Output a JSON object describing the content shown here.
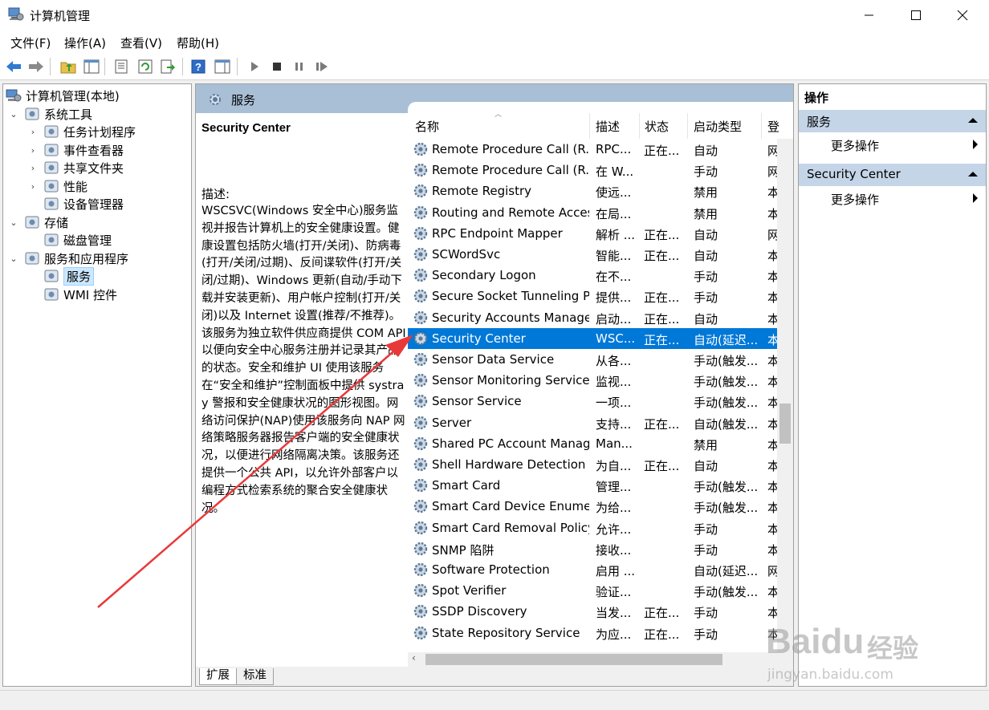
{
  "window": {
    "title": "计算机管理"
  },
  "menu": [
    "文件(F)",
    "操作(A)",
    "查看(V)",
    "帮助(H)"
  ],
  "tree": {
    "root": "计算机管理(本地)",
    "items": [
      {
        "label": "系统工具",
        "level": 1,
        "chevron": "⌄",
        "icon": "tools-icon"
      },
      {
        "label": "任务计划程序",
        "level": 2,
        "chevron": "›",
        "icon": "clock-icon"
      },
      {
        "label": "事件查看器",
        "level": 2,
        "chevron": "›",
        "icon": "event-viewer-icon"
      },
      {
        "label": "共享文件夹",
        "level": 2,
        "chevron": "›",
        "icon": "shared-folder-icon"
      },
      {
        "label": "性能",
        "level": 2,
        "chevron": "›",
        "icon": "performance-icon"
      },
      {
        "label": "设备管理器",
        "level": 2,
        "chevron": "",
        "icon": "device-manager-icon"
      },
      {
        "label": "存储",
        "level": 1,
        "chevron": "⌄",
        "icon": "storage-icon"
      },
      {
        "label": "磁盘管理",
        "level": 2,
        "chevron": "",
        "icon": "disk-icon"
      },
      {
        "label": "服务和应用程序",
        "level": 1,
        "chevron": "⌄",
        "icon": "services-apps-icon"
      },
      {
        "label": "服务",
        "level": 2,
        "chevron": "",
        "icon": "gear-icon",
        "selected": true
      },
      {
        "label": "WMI 控件",
        "level": 2,
        "chevron": "",
        "icon": "wmi-icon"
      }
    ]
  },
  "center": {
    "header": "服务",
    "detail_title": "Security Center",
    "desc_label": "描述:",
    "desc_body": "WSCSVC(Windows 安全中心)服务监视并报告计算机上的安全健康设置。健康设置包括防火墙(打开/关闭)、防病毒(打开/关闭/过期)、反间谍软件(打开/关闭/过期)、Windows 更新(自动/手动下载并安装更新)、用户帐户控制(打开/关闭)以及 Internet 设置(推荐/不推荐)。该服务为独立软件供应商提供 COM API 以便向安全中心服务注册并记录其产品的状态。安全和维护 UI 使用该服务在“安全和维护”控制面板中提供 systray 警报和安全健康状况的图形视图。网络访问保护(NAP)使用该服务向 NAP 网络策略服务器报告客户端的安全健康状况，以便进行网络隔离决策。该服务还提供一个公共 API，以允许外部客户以编程方式检索系统的聚合安全健康状况。",
    "columns": {
      "name": "名称",
      "desc": "描述",
      "state": "状态",
      "type": "启动类型",
      "logon": "登"
    },
    "rows": [
      {
        "name": "Remote Procedure Call (R...",
        "desc": "RPC...",
        "state": "正在...",
        "type": "自动",
        "logon": "网"
      },
      {
        "name": "Remote Procedure Call (R...",
        "desc": "在 W...",
        "state": "",
        "type": "手动",
        "logon": "网"
      },
      {
        "name": "Remote Registry",
        "desc": "使远...",
        "state": "",
        "type": "禁用",
        "logon": "本"
      },
      {
        "name": "Routing and Remote Access",
        "desc": "在局...",
        "state": "",
        "type": "禁用",
        "logon": "本"
      },
      {
        "name": "RPC Endpoint Mapper",
        "desc": "解析 ...",
        "state": "正在...",
        "type": "自动",
        "logon": "网"
      },
      {
        "name": "SCWordSvc",
        "desc": "智能...",
        "state": "正在...",
        "type": "自动",
        "logon": "本"
      },
      {
        "name": "Secondary Logon",
        "desc": "在不...",
        "state": "",
        "type": "手动",
        "logon": "本"
      },
      {
        "name": "Secure Socket Tunneling P...",
        "desc": "提供...",
        "state": "正在...",
        "type": "手动",
        "logon": "本"
      },
      {
        "name": "Security Accounts Manager",
        "desc": "启动...",
        "state": "正在...",
        "type": "自动",
        "logon": "本"
      },
      {
        "name": "Security Center",
        "desc": "WSC...",
        "state": "正在...",
        "type": "自动(延迟...",
        "logon": "本",
        "selected": true
      },
      {
        "name": "Sensor Data Service",
        "desc": "从各...",
        "state": "",
        "type": "手动(触发...",
        "logon": "本"
      },
      {
        "name": "Sensor Monitoring Service",
        "desc": "监视...",
        "state": "",
        "type": "手动(触发...",
        "logon": "本"
      },
      {
        "name": "Sensor Service",
        "desc": "一项...",
        "state": "",
        "type": "手动(触发...",
        "logon": "本"
      },
      {
        "name": "Server",
        "desc": "支持...",
        "state": "正在...",
        "type": "自动(触发...",
        "logon": "本"
      },
      {
        "name": "Shared PC Account Manager",
        "desc": "Man...",
        "state": "",
        "type": "禁用",
        "logon": "本"
      },
      {
        "name": "Shell Hardware Detection",
        "desc": "为自...",
        "state": "正在...",
        "type": "自动",
        "logon": "本"
      },
      {
        "name": "Smart Card",
        "desc": "管理...",
        "state": "",
        "type": "手动(触发...",
        "logon": "本"
      },
      {
        "name": "Smart Card Device Enumer...",
        "desc": "为给...",
        "state": "",
        "type": "手动(触发...",
        "logon": "本"
      },
      {
        "name": "Smart Card Removal Policy",
        "desc": "允许...",
        "state": "",
        "type": "手动",
        "logon": "本"
      },
      {
        "name": "SNMP 陷阱",
        "desc": "接收...",
        "state": "",
        "type": "手动",
        "logon": "本"
      },
      {
        "name": "Software Protection",
        "desc": "启用 ...",
        "state": "",
        "type": "自动(延迟...",
        "logon": "网"
      },
      {
        "name": "Spot Verifier",
        "desc": "验证...",
        "state": "",
        "type": "手动(触发...",
        "logon": "本"
      },
      {
        "name": "SSDP Discovery",
        "desc": "当发...",
        "state": "正在...",
        "type": "手动",
        "logon": "本"
      },
      {
        "name": "State Repository Service",
        "desc": "为应...",
        "state": "正在...",
        "type": "手动",
        "logon": "本"
      }
    ],
    "tabs": [
      "扩展",
      "标准"
    ]
  },
  "actions": {
    "header": "操作",
    "sections": [
      {
        "title": "服务",
        "item": "更多操作"
      },
      {
        "title": "Security Center",
        "item": "更多操作"
      }
    ]
  },
  "watermark": {
    "brand": "Bai",
    "brand2": "du",
    "cn": "经验",
    "url": "jingyan.baidu.com"
  },
  "colors": {
    "selection": "#0078d7",
    "header_band": "#a9bfd6",
    "action_section": "#c5d5e8",
    "arrow": "#e8393a"
  }
}
